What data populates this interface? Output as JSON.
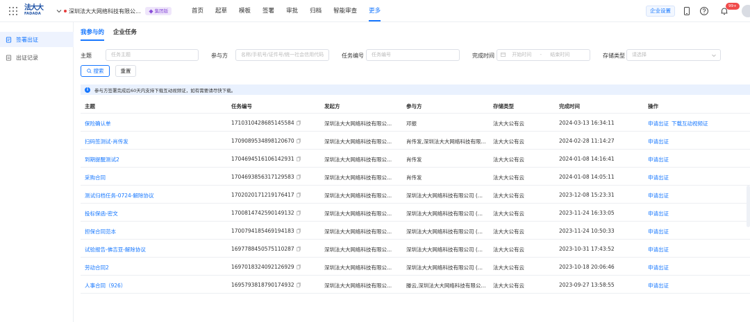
{
  "header": {
    "logo_text": "法大大",
    "logo_sub": "FADADA",
    "company_name": "深圳法大大网络科技有限公...",
    "group_badge": "集团版",
    "nav": [
      "首页",
      "起草",
      "模板",
      "签署",
      "审批",
      "归档",
      "智能审查",
      "更多"
    ],
    "active_nav": "更多",
    "enterprise_settings": "企业设置",
    "notification_badge": "99+"
  },
  "sidebar": {
    "items": [
      {
        "label": "签署出证",
        "active": true
      },
      {
        "label": "出证记录",
        "active": false
      }
    ]
  },
  "tabs": [
    "我参与的",
    "企业任务"
  ],
  "filters": {
    "subject_label": "主题",
    "subject_placeholder": "任务主题",
    "participant_label": "参与方",
    "participant_placeholder": "名称/手机号/证件号/统一社会信用代码",
    "task_no_label": "任务编号",
    "task_no_placeholder": "任务编号",
    "complete_time_label": "完成时间",
    "start_placeholder": "开始时间",
    "range_sep": "-",
    "end_placeholder": "结束时间",
    "storage_label": "存储类型",
    "storage_placeholder": "请选择"
  },
  "buttons": {
    "search": "搜索",
    "reset": "重置"
  },
  "notice": "参与方签署完成后60天内支持下载互动视频证，如有需要请尽快下载。",
  "table": {
    "columns": [
      "主题",
      "任务编号",
      "发起方",
      "参与方",
      "存储类型",
      "完成时间",
      "操作"
    ],
    "rows": [
      {
        "subject": "保险确认单",
        "task_no": "1710310428685145584",
        "initiator": "深圳法大大网络科技有限公...",
        "participant": "邓振",
        "storage": "法大大公有云",
        "time": "2024-03-13 16:34:11",
        "actions": [
          "申请出证",
          "下载互动视频证"
        ]
      },
      {
        "subject": "扫码签测试-肖传发",
        "task_no": "1709089534898120670",
        "initiator": "深圳法大大网络科技有限公...",
        "participant": "肖传发,深圳法大大网络科技有限...",
        "storage": "法大大公有云",
        "time": "2024-02-28 11:14:27",
        "actions": [
          "申请出证"
        ]
      },
      {
        "subject": "到期提醒测试2",
        "task_no": "1704694516106142931",
        "initiator": "深圳法大大网络科技有限公...",
        "participant": "肖传发",
        "storage": "法大大公有云",
        "time": "2024-01-08 14:16:41",
        "actions": [
          "申请出证"
        ]
      },
      {
        "subject": "采购合同",
        "task_no": "1704693856317129583",
        "initiator": "深圳法大大网络科技有限公...",
        "participant": "肖传发",
        "storage": "法大大公有云",
        "time": "2024-01-08 14:05:11",
        "actions": [
          "申请出证"
        ]
      },
      {
        "subject": "测试归档任务-0724-解除协议",
        "task_no": "1702020171219176417",
        "initiator": "深圳法大大网络科技有限公...",
        "participant": "深圳法大大网络科技有限公司 (...",
        "storage": "法大大公有云",
        "time": "2023-12-08 15:23:31",
        "actions": [
          "申请出证"
        ]
      },
      {
        "subject": "投标保函-密文",
        "task_no": "1700814742590149132",
        "initiator": "深圳法大大网络科技有限公...",
        "participant": "深圳法大大网络科技有限公司 (...",
        "storage": "法大大公有云",
        "time": "2023-11-24 16:33:05",
        "actions": [
          "申请出证"
        ]
      },
      {
        "subject": "担保合同范本",
        "task_no": "1700794185469194183",
        "initiator": "深圳法大大网络科技有限公...",
        "participant": "深圳法大大网络科技有限公司 (...",
        "storage": "法大大公有云",
        "time": "2023-11-24 10:50:33",
        "actions": [
          "申请出证"
        ]
      },
      {
        "subject": "试验报告-佛吉亚-解除协议",
        "task_no": "1697788450575110287",
        "initiator": "深圳法大大网络科技有限公...",
        "participant": "深圳法大大网络科技有限公司 (...",
        "storage": "法大大公有云",
        "time": "2023-10-31 17:43:52",
        "actions": [
          "申请出证"
        ]
      },
      {
        "subject": "劳动合同2",
        "task_no": "1697018324092126929",
        "initiator": "深圳法大大网络科技有限公...",
        "participant": "深圳法大大网络科技有限公司 (...",
        "storage": "法大大公有云",
        "time": "2023-10-18 20:06:46",
        "actions": [
          "申请出证"
        ]
      },
      {
        "subject": "人事合同（926）",
        "task_no": "1695793818790174932",
        "initiator": "深圳法大大网络科技有限公...",
        "participant": "滕云,深圳法大大网络科技有限公...",
        "storage": "法大大公有云",
        "time": "2023-09-27 13:58:55",
        "actions": [
          "申请出证"
        ]
      }
    ]
  },
  "colors": {
    "primary": "#1677ff",
    "badge_red": "#f04a4a",
    "notice_bg": "#e9f1fe",
    "group_badge_bg": "#efe6fb",
    "group_badge_text": "#8a4fd8"
  }
}
